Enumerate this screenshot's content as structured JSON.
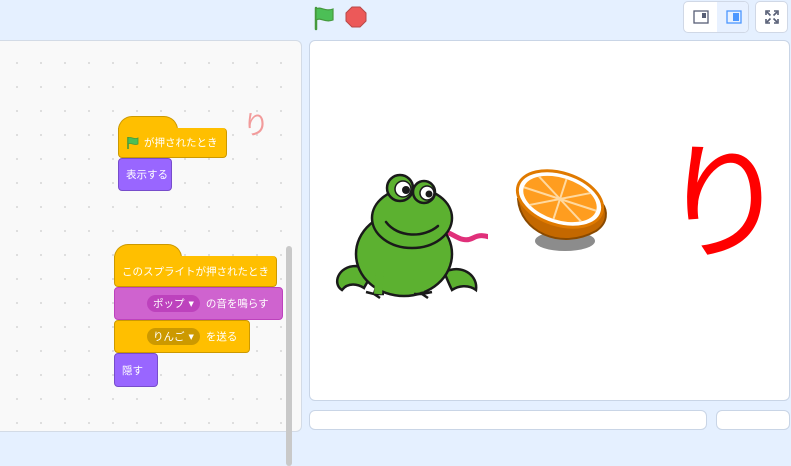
{
  "toolbar": {
    "green_flag_icon": "green-flag-icon",
    "stop_icon": "stop-icon",
    "layout_small_icon": "small-stage-icon",
    "layout_normal_icon": "normal-stage-icon",
    "fullscreen_icon": "fullscreen-icon"
  },
  "workspace": {
    "sprite_label": "り",
    "scripts": [
      {
        "hat": {
          "icon": "green-flag-icon",
          "label": "が押されたとき"
        },
        "blocks": [
          {
            "label": "表示する"
          }
        ]
      },
      {
        "hat": {
          "label": "このスプライトが押されたとき"
        },
        "blocks": [
          {
            "menu_value": "ポップ",
            "label": "の音を鳴らす"
          },
          {
            "menu_value": "りんご",
            "label": "を送る"
          },
          {
            "label": "隠す"
          }
        ]
      }
    ]
  },
  "stage": {
    "letter": "り",
    "sprites": [
      "frog",
      "orange"
    ]
  },
  "colors": {
    "events": "#ffbf00",
    "looks": "#9966ff",
    "sound": "#cf63cf",
    "stage_letter": "#ff0000",
    "green_flag": "#4cbf56",
    "stop": "#ec5959"
  }
}
